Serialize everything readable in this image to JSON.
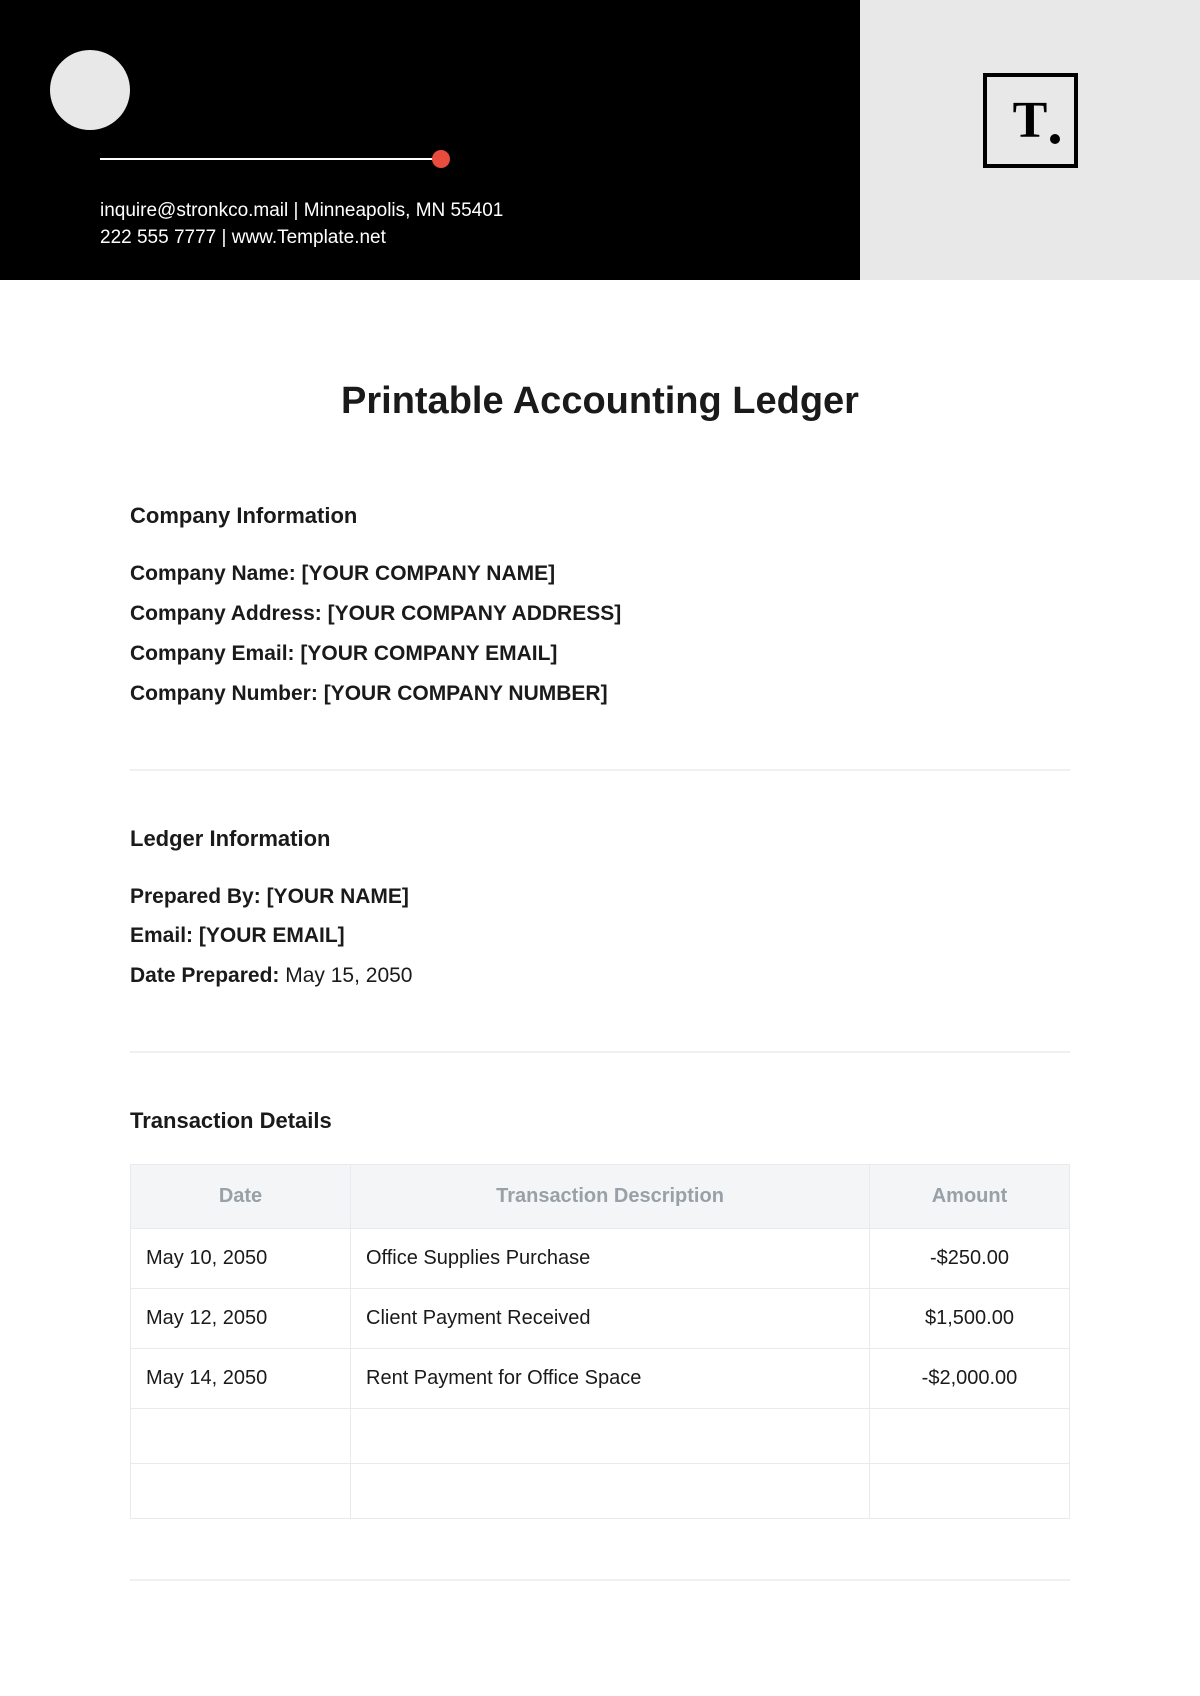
{
  "header": {
    "contact_line1": "inquire@stronkco.mail | Minneapolis, MN 55401",
    "contact_line2": "222 555 7777 |  www.Template.net",
    "logo_text": "T"
  },
  "title": "Printable Accounting Ledger",
  "company_section": {
    "heading": "Company Information",
    "name_label": "Company Name: ",
    "name_value": "[YOUR COMPANY NAME]",
    "address_label": "Company Address: ",
    "address_value": "[YOUR COMPANY ADDRESS]",
    "email_label": "Company Email: ",
    "email_value": "[YOUR COMPANY EMAIL]",
    "number_label": "Company Number: ",
    "number_value": "[YOUR COMPANY NUMBER]"
  },
  "ledger_section": {
    "heading": "Ledger Information",
    "prepared_by_label": "Prepared By: ",
    "prepared_by_value": "[YOUR NAME]",
    "email_label": "Email: ",
    "email_value": "[YOUR EMAIL]",
    "date_label": "Date Prepared: ",
    "date_value": "May 15, 2050"
  },
  "transactions": {
    "heading": "Transaction Details",
    "headers": {
      "date": "Date",
      "description": "Transaction Description",
      "amount": "Amount"
    },
    "rows": [
      {
        "date": "May 10, 2050",
        "description": "Office Supplies Purchase",
        "amount": "-$250.00"
      },
      {
        "date": "May 12, 2050",
        "description": "Client Payment Received",
        "amount": "$1,500.00"
      },
      {
        "date": "May 14, 2050",
        "description": "Rent Payment for Office Space",
        "amount": "-$2,000.00"
      },
      {
        "date": "",
        "description": "",
        "amount": ""
      },
      {
        "date": "",
        "description": "",
        "amount": ""
      }
    ]
  }
}
